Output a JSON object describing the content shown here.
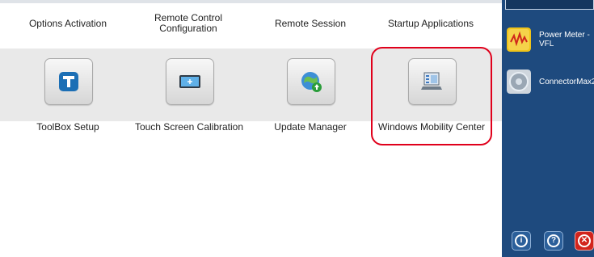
{
  "top_row": {
    "options_activation": "Options Activation",
    "remote_control_line1": "Remote Control",
    "remote_control_line2": "Configuration",
    "remote_session": "Remote Session",
    "startup_applications": "Startup Applications"
  },
  "tools": [
    {
      "label": "ToolBox Setup",
      "icon": "toolbox-setup-icon"
    },
    {
      "label": "Touch Screen Calibration",
      "icon": "touch-screen-calibration-icon"
    },
    {
      "label": "Update Manager",
      "icon": "update-manager-icon"
    },
    {
      "label": "Windows Mobility Center",
      "icon": "windows-mobility-center-icon"
    }
  ],
  "sidebar": {
    "apps": [
      {
        "line1": "Power Meter -",
        "line2": "VFL",
        "icon": "power-meter-icon"
      },
      {
        "line1": "ConnectorMax2",
        "line2": "",
        "icon": "connectormax-icon"
      }
    ],
    "buttons": [
      {
        "glyph": "i",
        "icon": "info-icon"
      },
      {
        "glyph": "?",
        "icon": "help-icon"
      },
      {
        "glyph": "✕",
        "icon": "close-icon"
      }
    ]
  },
  "colors": {
    "sidebar_bg": "#1e4a7e",
    "highlight": "#e0001b",
    "band_bg": "#e9e9e9"
  }
}
